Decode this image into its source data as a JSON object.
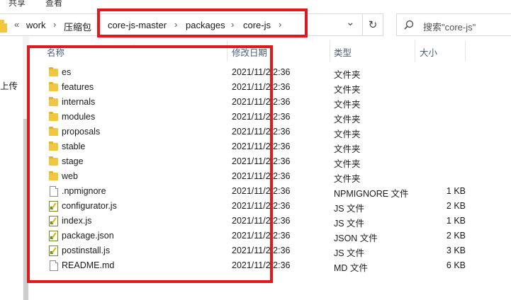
{
  "ribbon": {
    "share": "共享",
    "view": "查看"
  },
  "address": {
    "overflow": "«",
    "crumbs": [
      "work",
      "压缩包",
      "core-js-master",
      "packages",
      "core-js"
    ],
    "sep": "›",
    "dropdown": "⌄",
    "refresh": "↻"
  },
  "search": {
    "placeholder": "搜索\"core-js\""
  },
  "nav": {
    "upload": "上传"
  },
  "columns": {
    "name": "名称",
    "date": "修改日期",
    "type": "类型",
    "size": "大小"
  },
  "files": [
    {
      "name": "es",
      "date": "2021/11/2 2:36",
      "type": "文件夹",
      "size": "",
      "icon": "folder-icon"
    },
    {
      "name": "features",
      "date": "2021/11/2 2:36",
      "type": "文件夹",
      "size": "",
      "icon": "folder-icon"
    },
    {
      "name": "internals",
      "date": "2021/11/2 2:36",
      "type": "文件夹",
      "size": "",
      "icon": "folder-icon"
    },
    {
      "name": "modules",
      "date": "2021/11/2 2:36",
      "type": "文件夹",
      "size": "",
      "icon": "folder-icon"
    },
    {
      "name": "proposals",
      "date": "2021/11/2 2:36",
      "type": "文件夹",
      "size": "",
      "icon": "folder-icon"
    },
    {
      "name": "stable",
      "date": "2021/11/2 2:36",
      "type": "文件夹",
      "size": "",
      "icon": "folder-icon"
    },
    {
      "name": "stage",
      "date": "2021/11/2 2:36",
      "type": "文件夹",
      "size": "",
      "icon": "folder-icon"
    },
    {
      "name": "web",
      "date": "2021/11/2 2:36",
      "type": "文件夹",
      "size": "",
      "icon": "folder-icon"
    },
    {
      "name": ".npmignore",
      "date": "2021/11/2 2:36",
      "type": "NPMIGNORE 文件",
      "size": "1 KB",
      "icon": "file-icon"
    },
    {
      "name": "configurator.js",
      "date": "2021/11/2 2:36",
      "type": "JS 文件",
      "size": "2 KB",
      "icon": "js-file-icon"
    },
    {
      "name": "index.js",
      "date": "2021/11/2 2:36",
      "type": "JS 文件",
      "size": "1 KB",
      "icon": "js-file-icon"
    },
    {
      "name": "package.json",
      "date": "2021/11/2 2:36",
      "type": "JSON 文件",
      "size": "2 KB",
      "icon": "js-file-icon"
    },
    {
      "name": "postinstall.js",
      "date": "2021/11/2 2:36",
      "type": "JS 文件",
      "size": "3 KB",
      "icon": "js-file-icon"
    },
    {
      "name": "README.md",
      "date": "2021/11/2 2:36",
      "type": "MD 文件",
      "size": "6 KB",
      "icon": "file-icon"
    }
  ],
  "colors": {
    "annotation": "#e2191c",
    "folder": "#f3c640",
    "header_text": "#4c607a"
  }
}
